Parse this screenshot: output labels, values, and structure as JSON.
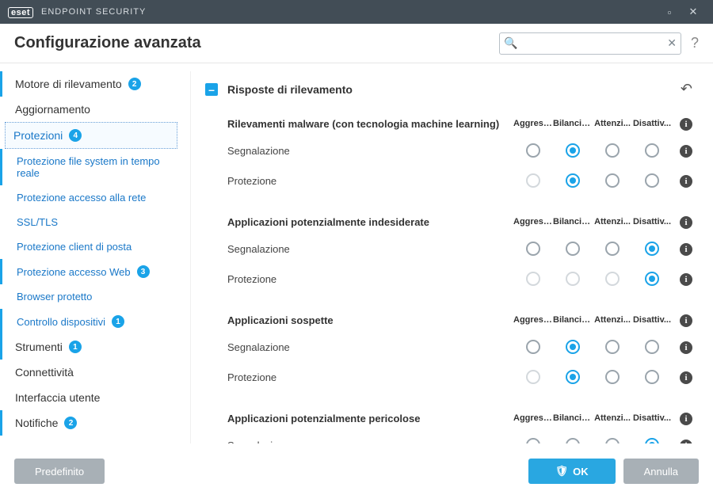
{
  "titlebar": {
    "brand": "eset",
    "product": "ENDPOINT SECURITY"
  },
  "header": {
    "title": "Configurazione avanzata",
    "search_placeholder": "",
    "help": "?"
  },
  "sidebar": {
    "items": [
      {
        "label": "Motore di rilevamento",
        "badge": "2",
        "type": "top",
        "accent": true
      },
      {
        "label": "Aggiornamento",
        "type": "top"
      },
      {
        "label": "Protezioni",
        "badge": "4",
        "type": "top",
        "selected": true
      },
      {
        "label": "Protezione file system in tempo reale",
        "type": "sub",
        "accent": true
      },
      {
        "label": "Protezione accesso alla rete",
        "type": "sub"
      },
      {
        "label": "SSL/TLS",
        "type": "sub"
      },
      {
        "label": "Protezione client di posta",
        "type": "sub"
      },
      {
        "label": "Protezione accesso Web",
        "badge": "3",
        "type": "sub",
        "accent": true
      },
      {
        "label": "Browser protetto",
        "type": "sub"
      },
      {
        "label": "Controllo dispositivi",
        "badge": "1",
        "type": "sub",
        "accent": true
      },
      {
        "label": "Strumenti",
        "badge": "1",
        "type": "top",
        "accent": true
      },
      {
        "label": "Connettività",
        "type": "top"
      },
      {
        "label": "Interfaccia utente",
        "type": "top"
      },
      {
        "label": "Notifiche",
        "badge": "2",
        "type": "top",
        "accent": true
      }
    ]
  },
  "panel": {
    "section_title": "Risposte di rilevamento",
    "columns": [
      "Aggress...",
      "Bilancia...",
      "Attenzi...",
      "Disattiv..."
    ],
    "groups": [
      {
        "title": "Rilevamenti malware (con tecnologia machine learning)",
        "rows": [
          {
            "label": "Segnalazione",
            "selected": 1,
            "disabled": []
          },
          {
            "label": "Protezione",
            "selected": 1,
            "disabled": [
              0
            ]
          }
        ]
      },
      {
        "title": "Applicazioni potenzialmente indesiderate",
        "rows": [
          {
            "label": "Segnalazione",
            "selected": 3,
            "disabled": []
          },
          {
            "label": "Protezione",
            "selected": 3,
            "disabled": [
              0,
              1,
              2
            ]
          }
        ]
      },
      {
        "title": "Applicazioni sospette",
        "rows": [
          {
            "label": "Segnalazione",
            "selected": 1,
            "disabled": []
          },
          {
            "label": "Protezione",
            "selected": 1,
            "disabled": [
              0
            ]
          }
        ]
      },
      {
        "title": "Applicazioni potenzialmente pericolose",
        "rows": [
          {
            "label": "Segnalazione",
            "selected": 3,
            "disabled": []
          }
        ]
      }
    ]
  },
  "footer": {
    "default": "Predefinito",
    "ok": "OK",
    "cancel": "Annulla"
  }
}
